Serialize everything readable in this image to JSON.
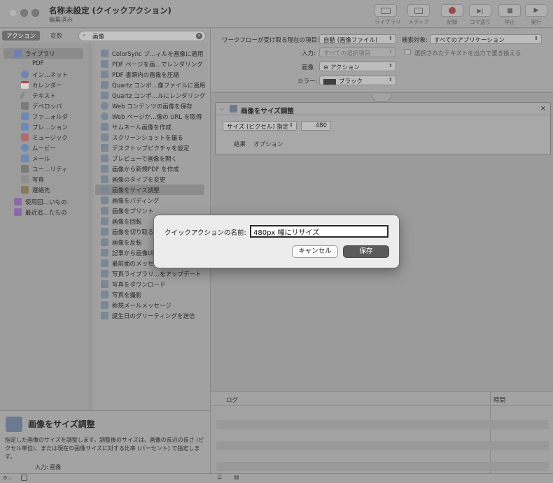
{
  "window": {
    "title": "名称未設定 (クイックアクション)",
    "subtitle": "編集済み"
  },
  "toolbar": {
    "buttons": [
      {
        "label": "ライブラリ",
        "icon": "library-icon"
      },
      {
        "label": "メディア",
        "icon": "media-icon"
      },
      {
        "label": "記録",
        "icon": "record-icon"
      },
      {
        "label": "コマ送り",
        "icon": "step-icon"
      },
      {
        "label": "中止",
        "icon": "stop-icon"
      },
      {
        "label": "実行",
        "icon": "run-icon"
      }
    ]
  },
  "left_toolbar": {
    "tab_actions": "アクション",
    "tab_variables": "変数",
    "search_value": "画像"
  },
  "library": {
    "items": [
      {
        "label": "ライブラリ",
        "color": "#6f7fb0"
      },
      {
        "label": "PDF",
        "color": "#9a9a9a"
      },
      {
        "label": "イン…ネット",
        "color": "#6a86b0"
      },
      {
        "label": "カレンダー",
        "color": "#d7d7d7"
      },
      {
        "label": "テキスト",
        "color": "#8a8a8a"
      },
      {
        "label": "デベロッパ",
        "color": "#7b7b7b"
      },
      {
        "label": "ファ…ォルダ",
        "color": "#6c8ab8"
      },
      {
        "label": "プレ…ション",
        "color": "#6c8ab8"
      },
      {
        "label": "ミュージック",
        "color": "#b06a72"
      },
      {
        "label": "ムービー",
        "color": "#6c8ab8"
      },
      {
        "label": "メール",
        "color": "#6c8ab8"
      },
      {
        "label": "ユー…リティ",
        "color": "#7b7b7b"
      },
      {
        "label": "写真",
        "color": "#8f8f8f"
      },
      {
        "label": "連絡先",
        "color": "#8b7a5a"
      },
      {
        "label": "使用回…いもの",
        "color": "#8a6aa8"
      },
      {
        "label": "最近追…たもの",
        "color": "#8a6aa8"
      }
    ]
  },
  "actions": {
    "items": [
      "ColorSync プ…ィルを画像に適用",
      "PDF ページを画…でレンダリング",
      "PDF 書類内の画像を圧縮",
      "Quartz コンポ…像ファイルに適用",
      "Quartz コンポ…ルにレンダリング",
      "Web コンテンツの画像を保存",
      "Web ページか…像の URL を取得",
      "サムネール画像を作成",
      "スクリーンショットを撮る",
      "デスクトップピクチャを設定",
      "プレビューで画像を開く",
      "画像から新規PDF を作成",
      "画像のタイプを変更",
      "画像をサイズ調整",
      "画像をパディング",
      "画像をプリント",
      "画像を回転",
      "画像を切り取る",
      "画像を反転",
      "記事から画像URL",
      "最前面のメッセー",
      "写真ライブラリ…をアップデート",
      "写真をダウンロード",
      "写真を撮影",
      "新規メールメッセージ",
      "誕生日のグリーティングを送信"
    ]
  },
  "description": {
    "title": "画像をサイズ調整",
    "body": "指定した画像のサイズを調整します。調整後のサイズは、画像の長辺の長さ (ピクセル単位)、または現在の画像サイズに対する比率 (パーセント) で指定します。",
    "input": "入力: 画像"
  },
  "workflow": {
    "receives_label": "ワークフローが受け取る現在の項目:",
    "receives_value": "自動 (画像ファイル)",
    "search_label": "検索対象:",
    "search_value": "すべてのアプリケーション",
    "input_label": "入力:",
    "input_value": "すべての選択項目",
    "replace_label": "選択されたテキストを出力で置き換える",
    "image_label": "画像",
    "image_value": "⊖ アクション",
    "color_label": "カラー:",
    "color_value": "ブラック"
  },
  "action_box": {
    "title": "画像をサイズ調整",
    "mode": "サイズ (ピクセル) 指定",
    "size": "480",
    "tab_results": "結果",
    "tab_options": "オプション"
  },
  "log": {
    "col_log": "ログ",
    "col_time": "時間"
  },
  "dialog": {
    "label": "クイックアクションの名前:",
    "value": "480px 幅にリサイズ",
    "cancel": "キャンセル",
    "save": "保存"
  }
}
